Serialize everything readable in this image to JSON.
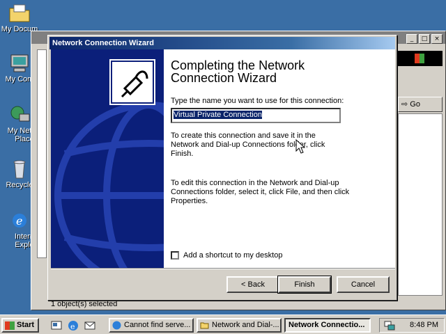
{
  "desktop": {
    "icons": [
      {
        "label": "My Documents",
        "icon": "folder-documents-icon"
      },
      {
        "label": "My Computer",
        "icon": "computer-icon"
      },
      {
        "label": "My Network Places",
        "icon": "network-places-icon"
      },
      {
        "label": "Recycle Bin",
        "icon": "recycle-bin-icon"
      },
      {
        "label": "Internet Explorer",
        "icon": "internet-explorer-icon"
      }
    ],
    "icon_visible_text": [
      "My Docum",
      "My Com",
      "My Net",
      "Place",
      "Recycle",
      "Intern",
      "Explo"
    ]
  },
  "background_window": {
    "go_label": "Go",
    "status": "1 object(s) selected",
    "partial_label": "A"
  },
  "wizard": {
    "title": "Network Connection Wizard",
    "heading_line1": "Completing the Network",
    "heading_line2": "Connection Wizard",
    "name_prompt": "Type the name you want to use for this connection:",
    "connection_name": "Virtual Private Connection",
    "para1": "To create this connection and save it in the Network and Dial-up Connections folder, click Finish.",
    "para2": "To edit this connection in the Network and Dial-up Connections folder, select it, click File, and then click Properties.",
    "shortcut_label": "Add a shortcut to my desktop",
    "shortcut_checked": false,
    "back_label": "< Back",
    "finish_label": "Finish",
    "cancel_label": "Cancel"
  },
  "taskbar": {
    "start_label": "Start",
    "tasks": [
      {
        "label": "Cannot find serve...",
        "active": false
      },
      {
        "label": "Network and Dial-...",
        "active": false
      },
      {
        "label": "Network Connectio...",
        "active": true
      }
    ],
    "clock": "8:48 PM"
  },
  "colors": {
    "desktop": "#3a6ea5",
    "title_active": "#0a246a",
    "banner": "#0b1f7a",
    "face": "#d4d0c8"
  }
}
